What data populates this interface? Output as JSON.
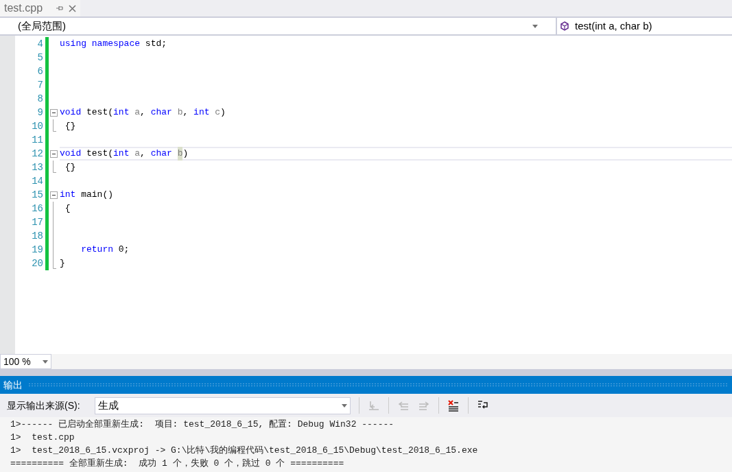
{
  "tabs": [
    {
      "label": "test.cpp",
      "selected": false
    }
  ],
  "nav": {
    "scope": "(全局范围)",
    "member": "test(int a, char b)"
  },
  "code_lines": [
    {
      "number": "4",
      "current": false,
      "kind": "plain",
      "tokens": [
        {
          "kind": "kw",
          "text": "using namespace"
        },
        {
          "kind": "plain",
          "text": " std;"
        }
      ]
    },
    {
      "number": "5",
      "current": false,
      "kind": "plain"
    },
    {
      "number": "6",
      "current": false,
      "kind": "plain"
    },
    {
      "number": "7",
      "current": false,
      "kind": "plain"
    },
    {
      "number": "8",
      "current": false,
      "kind": "plain"
    },
    {
      "number": "9",
      "current": false,
      "kind": "foldstart",
      "tokens": [
        {
          "kind": "kw",
          "text": "void"
        },
        {
          "kind": "plain",
          "text": " test("
        },
        {
          "kind": "kw",
          "text": "int"
        },
        {
          "kind": "param",
          "text": " a"
        },
        {
          "kind": "plain",
          "text": ", "
        },
        {
          "kind": "kw",
          "text": "char"
        },
        {
          "kind": "param",
          "text": " b"
        },
        {
          "kind": "plain",
          "text": ", "
        },
        {
          "kind": "kw",
          "text": "int"
        },
        {
          "kind": "param",
          "text": " c"
        },
        {
          "kind": "plain",
          "text": ")"
        }
      ]
    },
    {
      "number": "10",
      "current": false,
      "kind": "foldend",
      "tokens": [
        {
          "kind": "plain",
          "text": " {}"
        }
      ]
    },
    {
      "number": "11",
      "current": false,
      "kind": "plain"
    },
    {
      "number": "12",
      "current": true,
      "kind": "foldstart",
      "tokens": [
        {
          "kind": "kw",
          "text": "void"
        },
        {
          "kind": "plain",
          "text": " test("
        },
        {
          "kind": "kw",
          "text": "int"
        },
        {
          "kind": "param",
          "text": " a"
        },
        {
          "kind": "plain",
          "text": ", "
        },
        {
          "kind": "kw",
          "text": "char"
        },
        {
          "kind": "match",
          "text": "b"
        },
        {
          "kind": "plain",
          "text": ")"
        }
      ]
    },
    {
      "number": "13",
      "current": false,
      "kind": "foldend",
      "tokens": [
        {
          "kind": "plain",
          "text": " {}"
        }
      ]
    },
    {
      "number": "14",
      "current": false,
      "kind": "plain"
    },
    {
      "number": "15",
      "current": false,
      "kind": "foldstart",
      "tokens": [
        {
          "kind": "kw",
          "text": "int"
        },
        {
          "kind": "plain",
          "text": " main()"
        }
      ]
    },
    {
      "number": "16",
      "current": false,
      "kind": "foldbody",
      "tokens": [
        {
          "kind": "plain",
          "text": " {"
        }
      ]
    },
    {
      "number": "17",
      "current": false,
      "kind": "foldbody"
    },
    {
      "number": "18",
      "current": false,
      "kind": "foldbody"
    },
    {
      "number": "19",
      "current": false,
      "kind": "foldbody",
      "tokens": [
        {
          "kind": "kw",
          "text": "    return"
        },
        {
          "kind": "plain",
          "text": " 0;"
        }
      ]
    },
    {
      "number": "20",
      "current": false,
      "kind": "foldend",
      "tokens": [
        {
          "kind": "plain",
          "text": "}"
        }
      ]
    }
  ],
  "zoom": "100 %",
  "output": {
    "title": "输出",
    "source_label": "显示输出来源(S):",
    "source": "生成",
    "lines": [
      "1>------ 已启动全部重新生成:  项目: test_2018_6_15, 配置: Debug Win32 ------",
      "1>  test.cpp",
      "1>  test_2018_6_15.vcxproj -> G:\\比特\\我的编程代码\\test_2018_6_15\\Debug\\test_2018_6_15.exe",
      "========== 全部重新生成:  成功 1 个，失败 0 个，跳过 0 个 =========="
    ]
  }
}
